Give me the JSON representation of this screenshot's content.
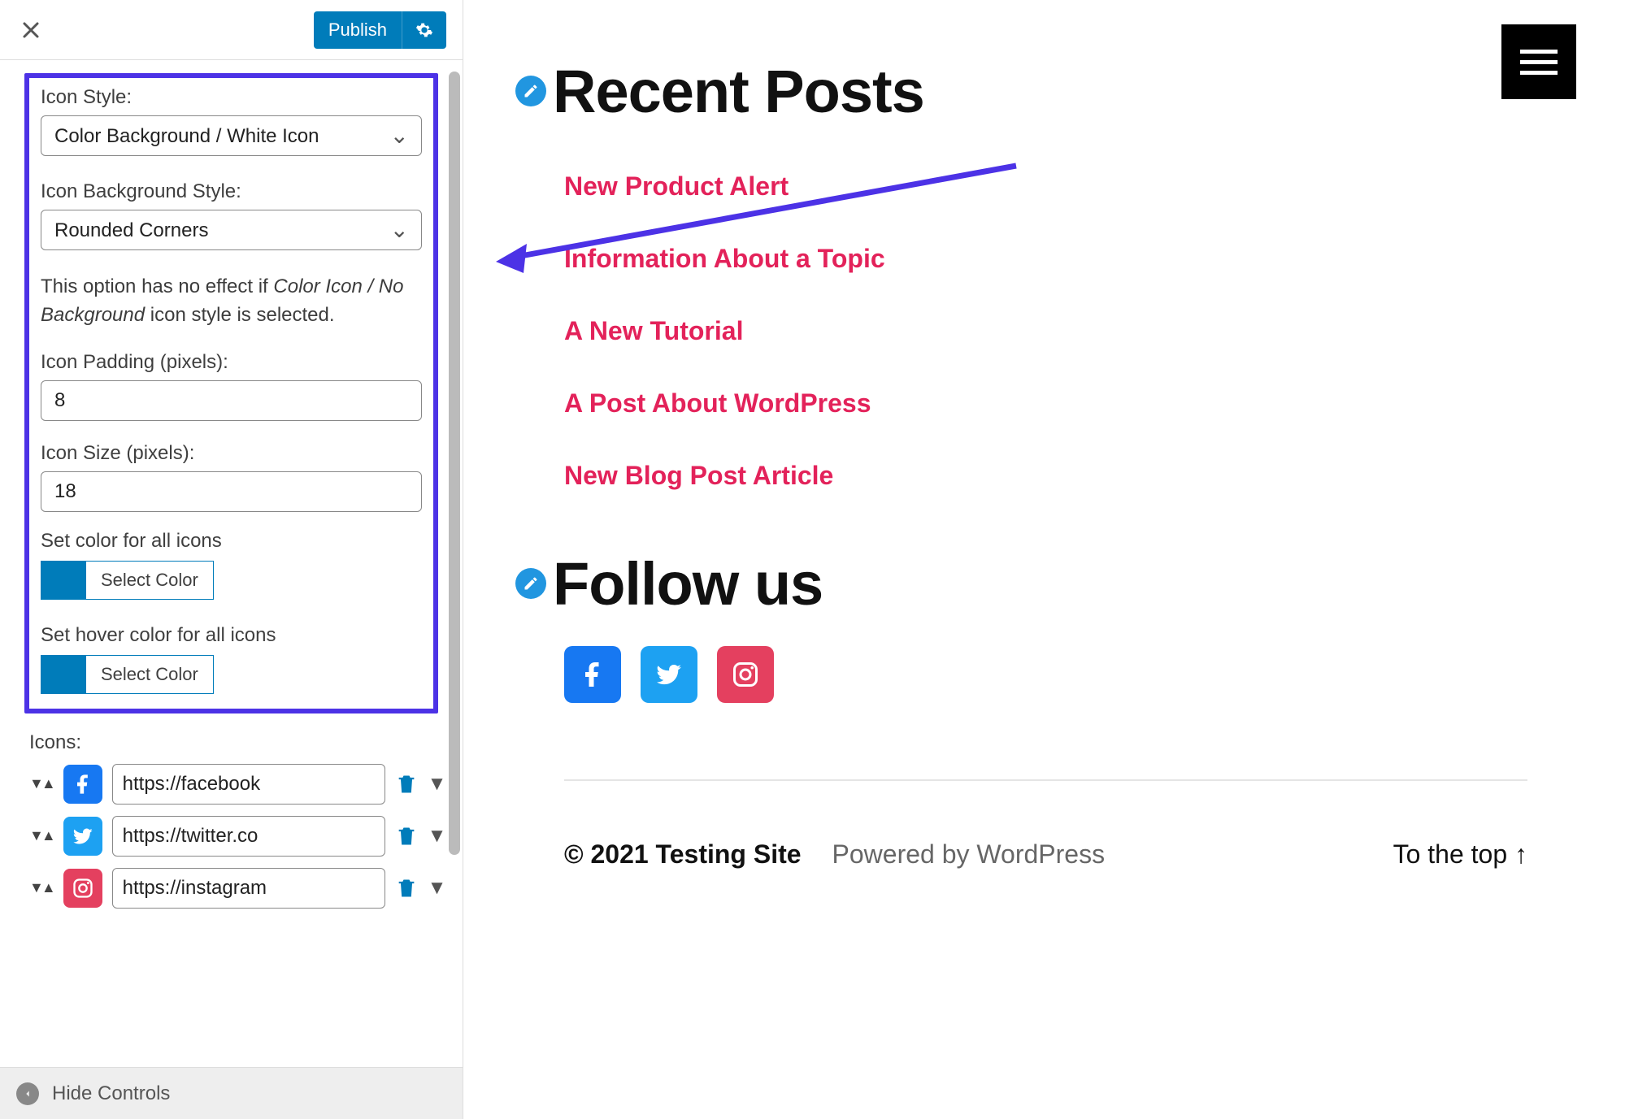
{
  "header": {
    "publish_label": "Publish"
  },
  "panel": {
    "icon_style_label": "Icon Style:",
    "icon_style_value": "Color Background / White Icon",
    "icon_bg_style_label": "Icon Background Style:",
    "icon_bg_style_value": "Rounded Corners",
    "helper_pre": "This option has no effect if ",
    "helper_em": "Color Icon / No Background",
    "helper_post": " icon style is selected.",
    "icon_padding_label": "Icon Padding (pixels):",
    "icon_padding_value": "8",
    "icon_size_label": "Icon Size (pixels):",
    "icon_size_value": "18",
    "set_color_label": "Set color for all icons",
    "select_color_btn": "Select Color",
    "set_hover_color_label": "Set hover color for all icons",
    "icons_section_label": "Icons:",
    "icons": [
      {
        "network": "facebook",
        "url": "https://facebook"
      },
      {
        "network": "twitter",
        "url": "https://twitter.co"
      },
      {
        "network": "instagram",
        "url": "https://instagram"
      }
    ]
  },
  "sidebar_footer": {
    "hide_controls": "Hide Controls"
  },
  "preview": {
    "recent_posts_heading": "Recent Posts",
    "posts": [
      "New Product Alert",
      "Information About a Topic",
      "A New Tutorial",
      "A Post About WordPress",
      "New Blog Post Article"
    ],
    "follow_heading": "Follow us",
    "footer_site": "© 2021 Testing Site",
    "footer_powered": "Powered by WordPress",
    "footer_top": "To the top ↑"
  }
}
